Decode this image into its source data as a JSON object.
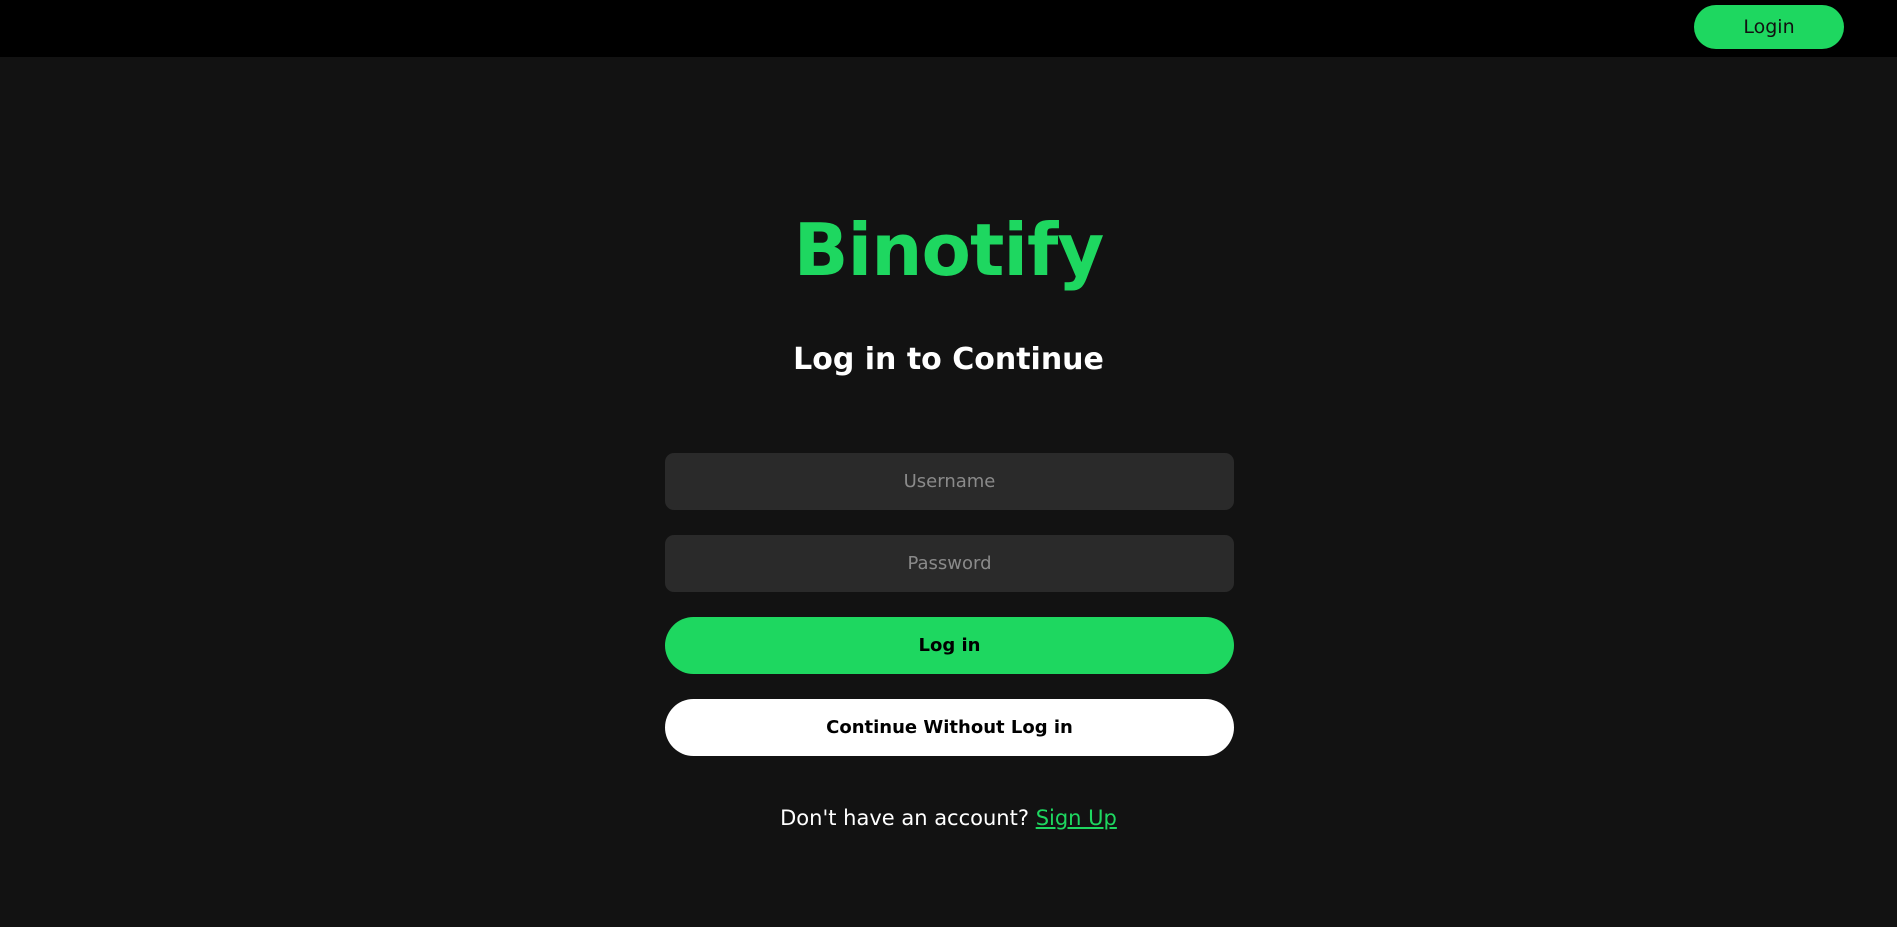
{
  "header": {
    "login_label": "Login"
  },
  "brand": {
    "name": "Binotify"
  },
  "form": {
    "heading": "Log in to Continue",
    "username_placeholder": "Username",
    "password_placeholder": "Password",
    "username_value": "",
    "password_value": "",
    "login_button": "Log in",
    "guest_button": "Continue Without Log in"
  },
  "signup": {
    "prompt": "Don't have an account?",
    "link_label": "Sign Up"
  },
  "colors": {
    "accent": "#1ed760",
    "background": "#121212",
    "topbar": "#000000",
    "input_bg": "#2a2a2a"
  }
}
